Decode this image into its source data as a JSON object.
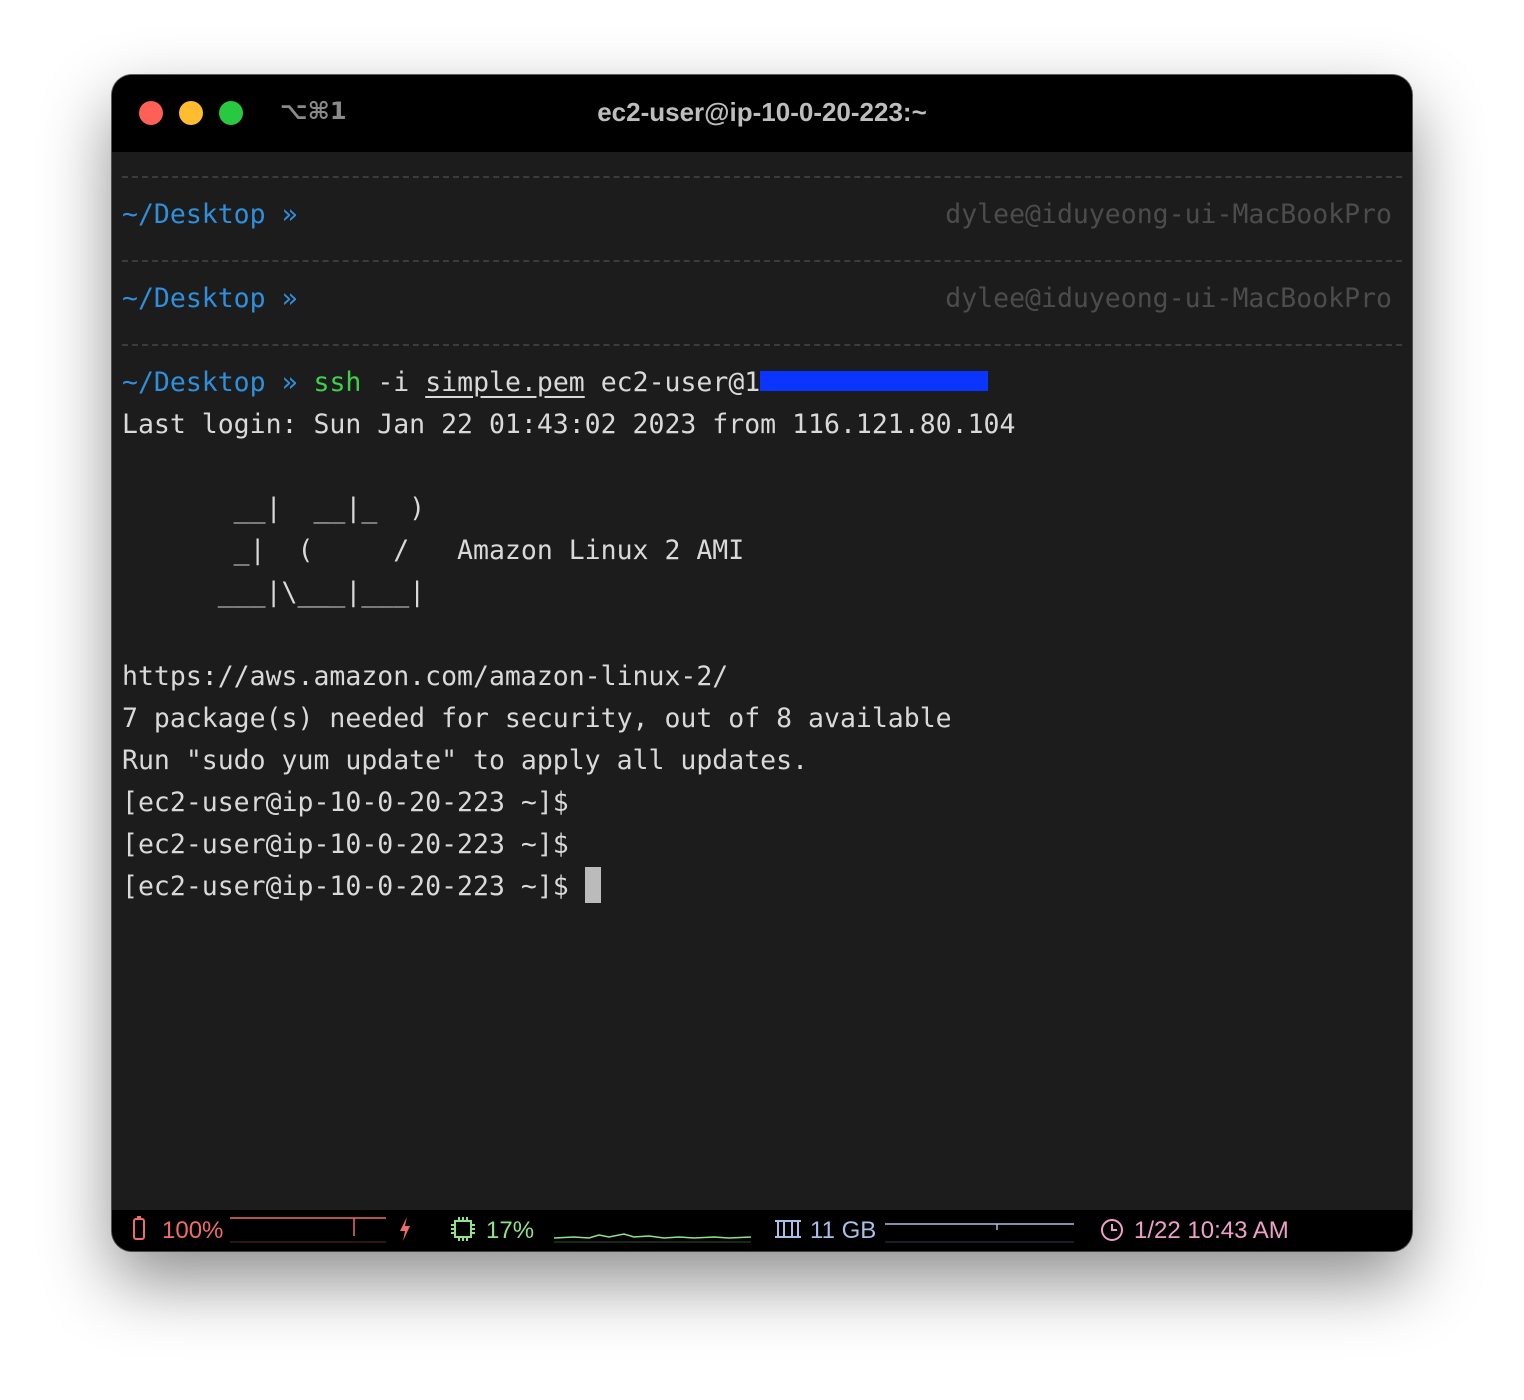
{
  "window": {
    "shortcut": "⌥⌘1",
    "title": "ec2-user@ip-10-0-20-223:~"
  },
  "terminal": {
    "prompt_dir": "~/Desktop",
    "prompt_chevron": "»",
    "right_prompt": "dylee@iduyeong-ui-MacBookPro",
    "ssh_cmd": "ssh",
    "ssh_flag": " -i ",
    "ssh_key": "simple.pem",
    "ssh_target": " ec2-user@1",
    "last_login": "Last login: Sun Jan 22 01:43:02 2023 from 116.121.80.104",
    "ascii_1": "       __|  __|_  )",
    "ascii_2": "       _|  (     /   Amazon Linux 2 AMI",
    "ascii_3": "      ___|\\___|___|",
    "url": "https://aws.amazon.com/amazon-linux-2/",
    "packages": "7 package(s) needed for security, out of 8 available",
    "run_update": "Run \"sudo yum update\" to apply all updates.",
    "shell_prompt": "[ec2-user@ip-10-0-20-223 ~]$"
  },
  "statusbar": {
    "battery_icon": "battery-icon",
    "battery": "100%",
    "charging_icon": "bolt-icon",
    "cpu_icon": "cpu-chip-icon",
    "cpu": "17%",
    "memory_icon": "memory-icon",
    "memory": "11 GB",
    "clock_icon": "clock-icon",
    "datetime": "1/22 10:43 AM",
    "colors": {
      "battery": "#f06b6b",
      "cpu": "#8fe388",
      "memory": "#a8bfe8",
      "clock": "#f0a0c8"
    }
  }
}
